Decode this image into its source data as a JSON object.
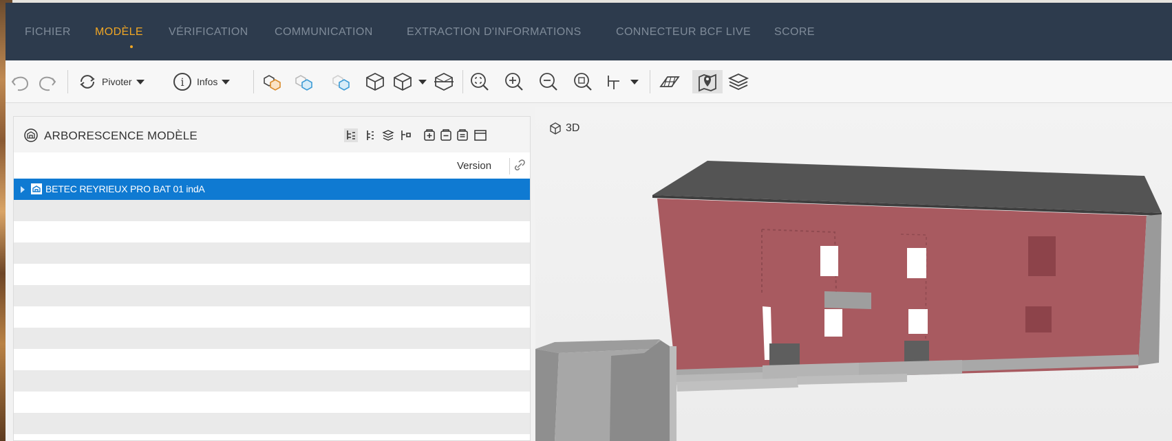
{
  "menu": {
    "items": [
      {
        "label": "FICHIER",
        "active": false
      },
      {
        "label": "MODÈLE",
        "active": true
      },
      {
        "label": "VÉRIFICATION",
        "active": false
      },
      {
        "label": "COMMUNICATION",
        "active": false
      },
      {
        "label": "EXTRACTION D'INFORMATIONS",
        "active": false
      },
      {
        "label": "CONNECTEUR BCF LIVE",
        "active": false
      },
      {
        "label": "SCORE",
        "active": false
      }
    ]
  },
  "toolbar": {
    "rotate_label": "Pivoter",
    "info_label": "Infos",
    "icons": [
      "undo-icon",
      "redo-icon",
      "rotate-icon",
      "info-icon",
      "show-objects-icon",
      "hide-objects-icon",
      "isolate-icon",
      "cube-view-icon",
      "section-box-icon",
      "zoom-fit-icon",
      "zoom-in-icon",
      "zoom-out-icon",
      "zoom-selection-icon",
      "select-cursor-icon",
      "floor-plan-icon",
      "map-pin-icon",
      "layers-icon"
    ]
  },
  "tree_panel": {
    "title": "ARBORESCENCE MODÈLE",
    "column_version": "Version",
    "rows": [
      {
        "label": "BETEC REYRIEUX PRO BAT 01 indA",
        "selected": true
      }
    ]
  },
  "view": {
    "label": "3D"
  },
  "colors": {
    "menubar_bg": "#2d3b4d",
    "menu_active": "#f0a624",
    "menu_inactive": "#7f8b99",
    "selection": "#0f7ad2",
    "facade": "#a85a60",
    "roof": "#505050"
  }
}
